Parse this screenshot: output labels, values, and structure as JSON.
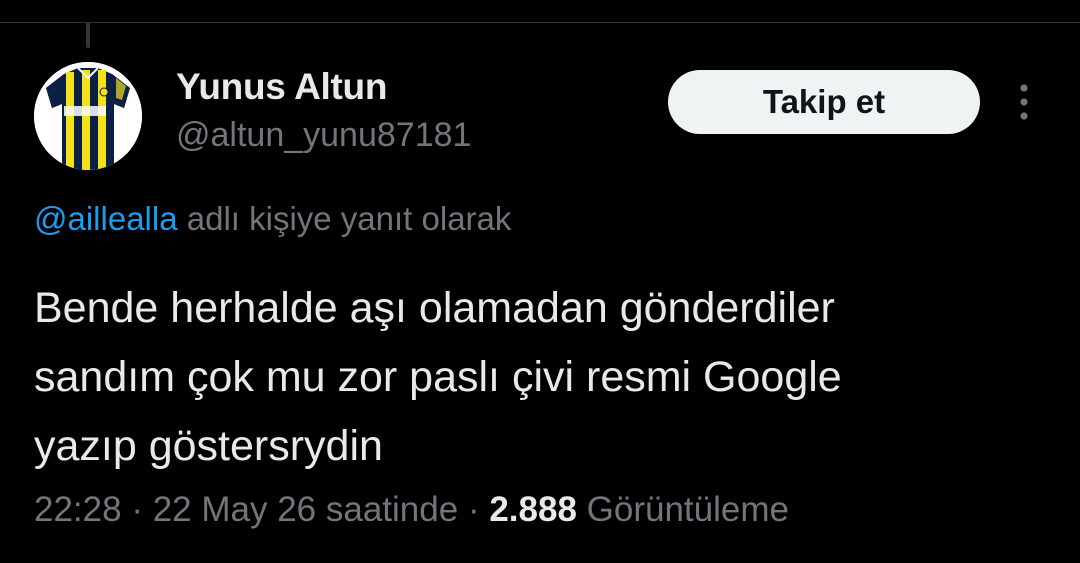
{
  "author": {
    "display_name": "Yunus Altun",
    "handle": "@altun_yunu87181",
    "avatar_icon": "fenerbahce-jersey-avatar",
    "avatar_text": "Otokoç"
  },
  "follow_button": {
    "label": "Takip et"
  },
  "more_button": {
    "icon": "more-vertical-icon"
  },
  "reply": {
    "mention": "@aillealla",
    "suffix": "adlı kişiye yanıt olarak"
  },
  "tweet": {
    "lines": [
      "Bende herhalde aşı olamadan gönderdiler",
      "sandım çok mu zor paslı çivi resmi Google",
      "yazıp göstersrydin"
    ]
  },
  "meta": {
    "time": "22:28",
    "separator": "·",
    "date_text": "22 May 26 saatinde",
    "views_count": "2.888",
    "views_label": "Görüntüleme"
  },
  "colors": {
    "background": "#000000",
    "primary_text": "#e7e9ea",
    "secondary_text": "#71767b",
    "link": "#1d9bf0",
    "button_bg": "#eff3f4",
    "jersey_yellow": "#f4e11a",
    "jersey_navy": "#0c1f44"
  }
}
